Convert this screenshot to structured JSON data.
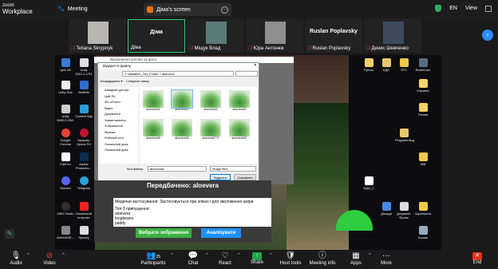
{
  "app": {
    "brand_line1": "zoom",
    "brand_line2": "Workplace",
    "meeting_label": "Meeting"
  },
  "share": {
    "title": "Діма's screen"
  },
  "top_right": {
    "lang": "EN",
    "view": "View"
  },
  "participants": [
    {
      "name": "Tetiana Skrypnyk",
      "muted": true
    },
    {
      "name": "Діма",
      "muted": false,
      "active": true
    },
    {
      "name": "Міщук Влад",
      "muted": true
    },
    {
      "name": "Юра Антонюк",
      "muted": true
    },
    {
      "name": "Ruslan Poplavsky",
      "muted": true,
      "center_name": "Ruslan Poplavsky"
    },
    {
      "name": "Денис Шевченко",
      "muted": true
    }
  ],
  "desktop_icons_left": [
    {
      "label": "Цей ПК"
    },
    {
      "label": "Unity 2021.1.17f1"
    },
    {
      "label": "Unity Hub"
    },
    {
      "label": "BeatMe"
    },
    {
      "label": "Unity 6000.0.23f1"
    },
    {
      "label": "Content Mgr"
    },
    {
      "label": "Google Chrome"
    },
    {
      "label": "Браузер Opera GX"
    },
    {
      "label": "СапСот"
    },
    {
      "label": "Adobe Photosho..."
    },
    {
      "label": "Discord"
    },
    {
      "label": "Telegram"
    },
    {
      "label": "OBS Studio"
    },
    {
      "label": "Безпечний інтернет"
    },
    {
      "label": "ArhivIAOE..."
    },
    {
      "label": "Spacey"
    }
  ],
  "desktop_icons_right": [
    {
      "label": "Python"
    },
    {
      "label": "ЕДЕ"
    },
    {
      "label": "YPC"
    },
    {
      "label": "RobinCoin"
    },
    {
      "label": "Корзина"
    },
    {
      "label": "Тетяна"
    },
    {
      "label": "Programming"
    },
    {
      "label": "Мій"
    },
    {
      "label": "Курс_2"
    },
    {
      "label": "Доходи"
    },
    {
      "label": "Документ Франк"
    },
    {
      "label": "Скриншоти"
    },
    {
      "label": "Кошик"
    }
  ],
  "tk_app": {
    "prediction": "Передбачено: aloevera",
    "output_line1": "Медичне застосування: Застосовується при опіках і для зволоження шкіри",
    "output_line2": "Топ-3 припущення:",
    "output_line3": "aloevera",
    "output_line4": "longbeans",
    "output_line5": "paddy",
    "pick_button": "Вибрати зображення",
    "analyze_button": "Аналізувати"
  },
  "bg_window_title": "Визначення рослин за фото",
  "dialog": {
    "title": "Відкриття файлу",
    "address": "« Validation_Set_Folder » aloevera",
    "toolbar_organize": "Упорядкувати ▾",
    "toolbar_newfolder": "Створити папку",
    "tree": [
      "Швидкий доступ",
      "Цей ПК",
      "3D-об'єкти",
      "Відео",
      "Документи",
      "Завантаження",
      "Зображення",
      "Музика",
      "Робочий стіл",
      "Локальний диск",
      "Локальний диск"
    ],
    "files": [
      "aloevera01",
      "aloevera02",
      "aloevera03",
      "aloevera04",
      "aloevera05",
      "aloevera06",
      "aloevera0772",
      "aloevera097"
    ],
    "filename_label": "Ім'я файлу:",
    "filename_value": "aloevera8",
    "filter": "Image files",
    "open": "Відкрити",
    "cancel": "Скасувати"
  },
  "toolbar": {
    "audio": "Audio",
    "video": "Video",
    "participants": "Participants",
    "participants_count": "25",
    "chat": "Chat",
    "react": "React",
    "share": "Share",
    "host_tools": "Host tools",
    "meeting_info": "Meeting info",
    "apps": "Apps",
    "more": "More",
    "end": "End"
  }
}
